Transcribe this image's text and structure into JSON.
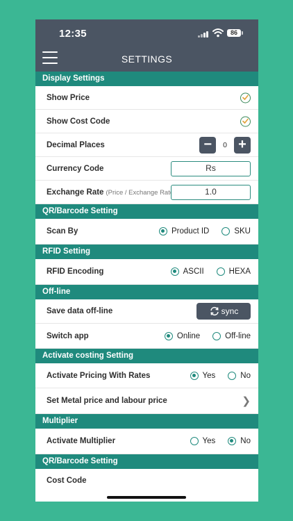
{
  "status_bar": {
    "time": "12:35",
    "battery": "86"
  },
  "header": {
    "title": "SETTINGS"
  },
  "display_settings": {
    "section_title": "Display Settings",
    "show_price_label": "Show Price",
    "show_cost_code_label": "Show Cost Code",
    "decimal_places_label": "Decimal Places",
    "decimal_places_value": "0",
    "currency_code_label": "Currency Code",
    "currency_code_value": "Rs",
    "exchange_rate_label": "Exchange Rate",
    "exchange_rate_sub": "(Price / Exchange Rate)",
    "exchange_rate_value": "1.0"
  },
  "qr_barcode": {
    "section_title": "QR/Barcode Setting",
    "scan_by_label": "Scan By",
    "option_product_id": "Product ID",
    "option_sku": "SKU",
    "selected": "Product ID"
  },
  "rfid": {
    "section_title": "RFID Setting",
    "encoding_label": "RFID Encoding",
    "option_ascii": "ASCII",
    "option_hexa": "HEXA",
    "selected": "ASCII"
  },
  "offline": {
    "section_title": "Off-line",
    "save_data_label": "Save data off-line",
    "sync_label": "sync",
    "switch_app_label": "Switch app",
    "option_online": "Online",
    "option_offline": "Off-line",
    "selected": "Online"
  },
  "costing": {
    "section_title": "Activate costing Setting",
    "pricing_label": "Activate Pricing With Rates",
    "option_yes": "Yes",
    "option_no": "No",
    "selected": "Yes",
    "metal_price_label": "Set Metal price and labour price"
  },
  "multiplier": {
    "section_title": "Multiplier",
    "activate_label": "Activate Multiplier",
    "option_yes": "Yes",
    "option_no": "No",
    "selected": "No"
  },
  "qr_barcode_2": {
    "section_title": "QR/Barcode Setting",
    "cost_code_label": "Cost Code"
  },
  "colors": {
    "teal": "#1f8a7d",
    "header": "#4b5563",
    "background": "#3bb794"
  }
}
